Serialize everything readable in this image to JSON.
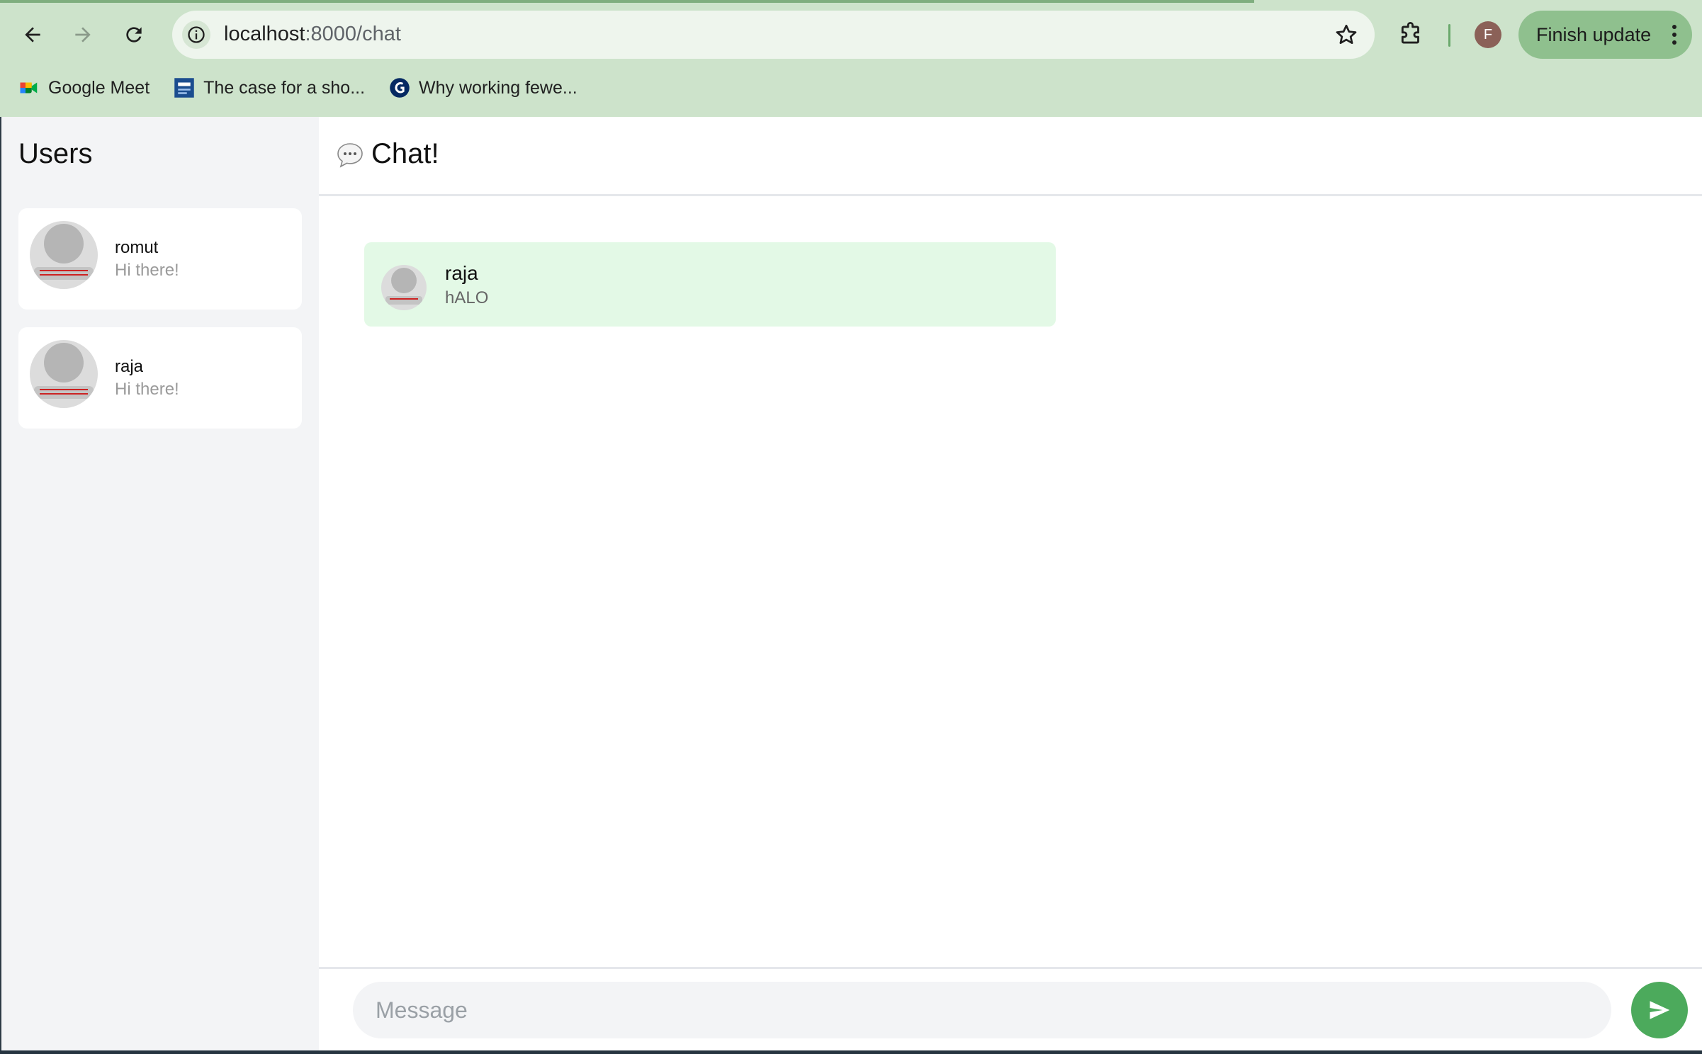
{
  "browser": {
    "url_host": "localhost",
    "url_path": ":8000/chat",
    "profile_initial": "F",
    "update_button": "Finish update",
    "bookmarks": [
      {
        "label": "Google Meet",
        "icon": "google-meet-icon"
      },
      {
        "label": "The case for a sho...",
        "icon": "bbc-worklife-icon"
      },
      {
        "label": "Why working fewe...",
        "icon": "guardian-icon"
      }
    ]
  },
  "sidebar": {
    "title": "Users",
    "users": [
      {
        "name": "romut",
        "last_message": "Hi there!"
      },
      {
        "name": "raja",
        "last_message": "Hi there!"
      }
    ]
  },
  "chat": {
    "title": "Chat!",
    "messages": [
      {
        "sender": "raja",
        "text": "hALO"
      }
    ],
    "input_placeholder": "Message"
  },
  "colors": {
    "chrome_bg": "#cde3cb",
    "sidebar_bg": "#f3f4f6",
    "message_bg": "#e3f9e6",
    "send_button": "#4caa5c"
  }
}
